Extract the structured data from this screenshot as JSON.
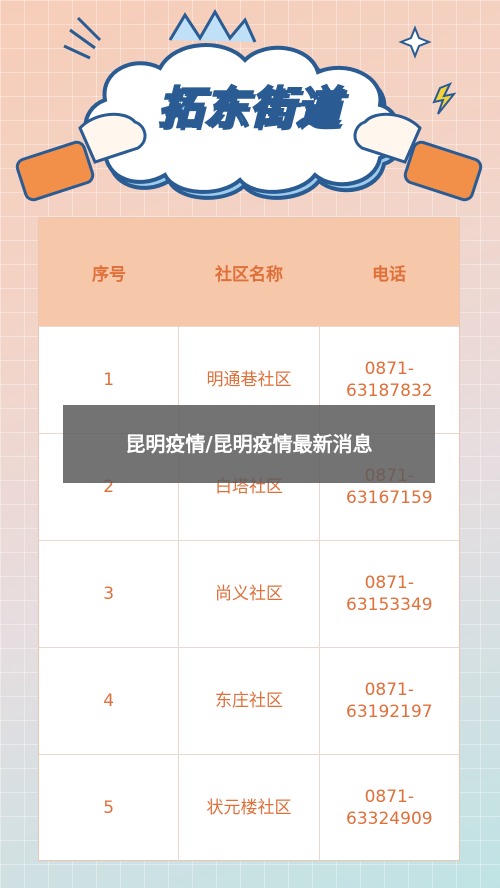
{
  "banner": {
    "title": "拓东街道"
  },
  "table": {
    "headers": [
      "序号",
      "社区名称",
      "电话"
    ],
    "rows": [
      {
        "no": "1",
        "name": "明通巷社区",
        "phone": "0871-\n63187832"
      },
      {
        "no": "2",
        "name": "白塔社区",
        "phone": "0871-\n63167159"
      },
      {
        "no": "3",
        "name": "尚义社区",
        "phone": "0871-\n63153349"
      },
      {
        "no": "4",
        "name": "东庄社区",
        "phone": "0871-\n63192197"
      },
      {
        "no": "5",
        "name": "状元楼社区",
        "phone": "0871-\n63324909"
      }
    ]
  },
  "caption": {
    "text": "昆明疫情/昆明疫情最新消息"
  },
  "colors": {
    "accent": "#e0703b",
    "header_bg": "#f6c8a9",
    "title_blue": "#2a5c93"
  }
}
